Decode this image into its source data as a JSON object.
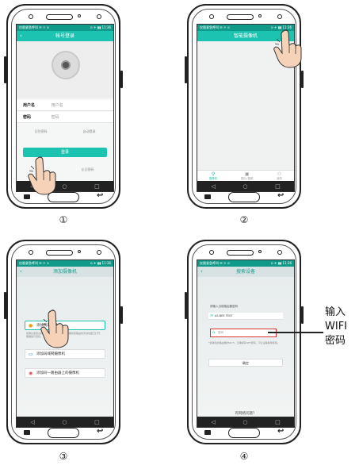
{
  "common": {
    "status_left": "仅限紧急呼叫 ✉ ☼ ⊙",
    "status_right": "⊙ ✈ ▮▮ 11:36",
    "nav_back": "◁",
    "nav_home": "○",
    "nav_recent": "□"
  },
  "steps": [
    {
      "label": "①"
    },
    {
      "label": "②"
    },
    {
      "label": "③"
    },
    {
      "label": "④"
    }
  ],
  "screen1": {
    "title": "帐号登录",
    "back": "‹",
    "username_label": "用户名",
    "username_placeholder": "用户名",
    "password_label": "密码",
    "password_placeholder": "密码",
    "remember": "记住密码",
    "auto_login": "自动登录",
    "login_button": "登录",
    "register": "注册",
    "forgot": "忘记密码"
  },
  "screen2": {
    "title": "智能摄像机",
    "tabs": [
      {
        "icon": "⚲",
        "label": "摄像机",
        "active": true
      },
      {
        "icon": "▣",
        "label": "图片/视频"
      },
      {
        "icon": "⚇",
        "label": "我的"
      }
    ]
  },
  "screen3": {
    "title": "添加摄像机",
    "back": "‹",
    "option1": "添加我的摄像机",
    "option1_desc": "如果在使用过的设备未联网，请先确认摄像机和路由的无线功能已打开，根据提示连接。",
    "option2": "添加局域网摄像机",
    "option3": "添加同一路由器上的摄像机"
  },
  "screen4": {
    "title": "搜索设备",
    "back": "‹",
    "prompt": "请输入当前路由器密码",
    "wifi_name": "AS-BEE TEST",
    "password_placeholder": "密码",
    "hint": "*选择您的路由器的Wi-Fi，正确填写WiFi密码，可让设备联网使用。",
    "confirm": "确定",
    "problem": "有网络问题？"
  },
  "annotation": {
    "line1": "输入",
    "line2": "WIFI",
    "line3": "密码"
  }
}
